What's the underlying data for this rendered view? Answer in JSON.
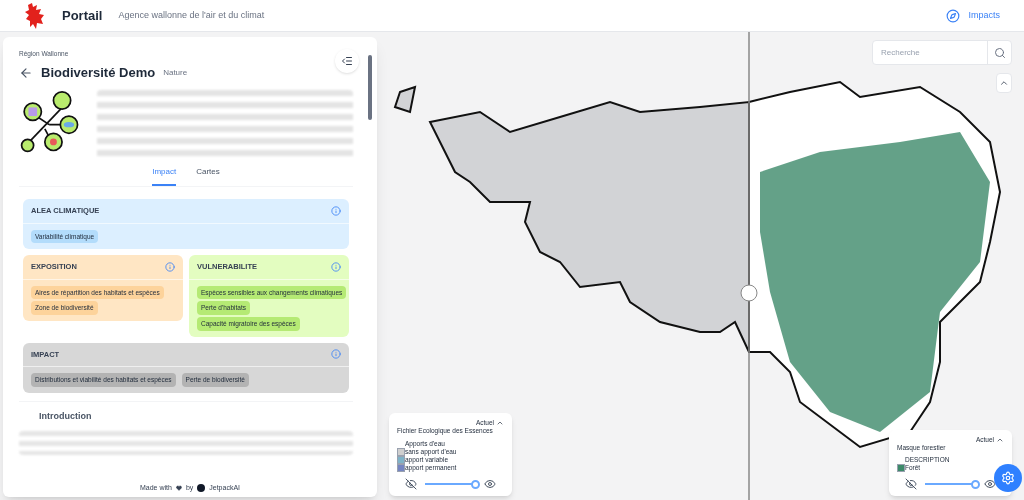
{
  "header": {
    "title": "Portail",
    "subtitle": "Agence wallonne de l'air et du climat",
    "link": "Impacts"
  },
  "panel": {
    "breadcrumb": "Région Wallonne",
    "title": "Biodiversité Demo",
    "tag": "Nature",
    "tabs": [
      {
        "label": "Impact",
        "selected": true
      },
      {
        "label": "Cartes",
        "selected": false
      }
    ],
    "cards": [
      {
        "title": "ALEA CLIMATIQUE",
        "kind": "alea",
        "chips": [
          "Variabilité climatique"
        ]
      },
      {
        "title": "EXPOSITION",
        "kind": "exposition",
        "chips": [
          "Aires de répartition des habitats et espèces",
          "Zone de biodiversité"
        ]
      },
      {
        "title": "VULNERABILITE",
        "kind": "vulnerabilite",
        "chips": [
          "Espèces sensibles aux changements climatiques",
          "Perte d'habitats",
          "Capacité migratoire des espèces"
        ]
      },
      {
        "title": "IMPACT",
        "kind": "impact",
        "chips": [
          "Distributions et viabilité des habitats et espèces",
          "Perte de biodiversité"
        ]
      }
    ],
    "section": "Introduction",
    "footer_prefix": "Made with",
    "footer_by": "by",
    "footer_brand": "JetpackAI"
  },
  "map": {
    "search_placeholder": "Recherche",
    "legends": [
      {
        "mode": "Actuel",
        "title": "Fichier Ecologique des Essences",
        "heading": "Apports d'eau",
        "level": 1.0,
        "items": [
          {
            "label": "sans apport d'eau",
            "color": "#cfcfcf"
          },
          {
            "label": "apport variable",
            "color": "#7fb3c8"
          },
          {
            "label": "apport permanent",
            "color": "#7585c2"
          }
        ]
      },
      {
        "mode": "Actuel",
        "title": "Masque forestier",
        "heading": "DESCRIPTION",
        "level": 1.0,
        "items": [
          {
            "label": "Forêt",
            "color": "#3d8a6a"
          }
        ]
      }
    ]
  }
}
